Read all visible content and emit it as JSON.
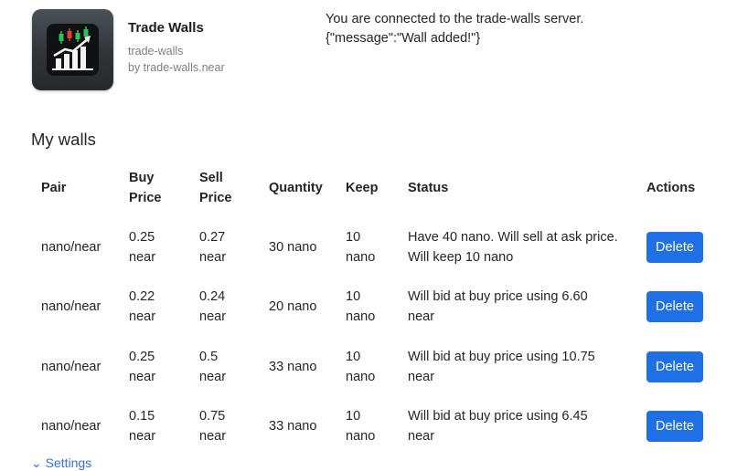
{
  "app": {
    "title": "Trade Walls",
    "id": "trade-walls",
    "author": "by trade-walls.near",
    "icon": "chart-icon"
  },
  "server": {
    "status": "You are connected to the trade-walls server.",
    "message": "{\"message\":\"Wall added!\"}"
  },
  "walls": {
    "title": "My walls",
    "headers": {
      "pair": "Pair",
      "buy_price_1": "Buy",
      "buy_price_2": "Price",
      "sell_price_1": "Sell",
      "sell_price_2": "Price",
      "quantity": "Quantity",
      "keep": "Keep",
      "status": "Status",
      "actions": "Actions"
    },
    "rows": [
      {
        "pair": "nano/near",
        "buy_1": "0.25",
        "buy_2": "near",
        "sell_1": "0.27",
        "sell_2": "near",
        "quantity": "30 nano",
        "keep_1": "10",
        "keep_2": "nano",
        "status_1": "Have 40 nano. Will sell at ask price.",
        "status_2": "Will keep 10 nano",
        "action": "Delete"
      },
      {
        "pair": "nano/near",
        "buy_1": "0.22",
        "buy_2": "near",
        "sell_1": "0.24",
        "sell_2": "near",
        "quantity": "20 nano",
        "keep_1": "10",
        "keep_2": "nano",
        "status_1": "Will bid at buy price using 6.60",
        "status_2": "near",
        "action": "Delete"
      },
      {
        "pair": "nano/near",
        "buy_1": "0.25",
        "buy_2": "near",
        "sell_1": "0.5",
        "sell_2": "near",
        "quantity": "33 nano",
        "keep_1": "10",
        "keep_2": "nano",
        "status_1": "Will bid at buy price using 10.75",
        "status_2": "near",
        "action": "Delete"
      },
      {
        "pair": "nano/near",
        "buy_1": "0.15",
        "buy_2": "near",
        "sell_1": "0.75",
        "sell_2": "near",
        "quantity": "33 nano",
        "keep_1": "10",
        "keep_2": "nano",
        "status_1": "Will bid at buy price using 6.45",
        "status_2": "near",
        "action": "Delete"
      }
    ]
  },
  "settings": {
    "label": "Settings",
    "icon": "chevron-down-icon"
  },
  "colors": {
    "accent": "#1f6fe5",
    "link": "#3a6fd8",
    "muted_text": "#7a7e85"
  }
}
